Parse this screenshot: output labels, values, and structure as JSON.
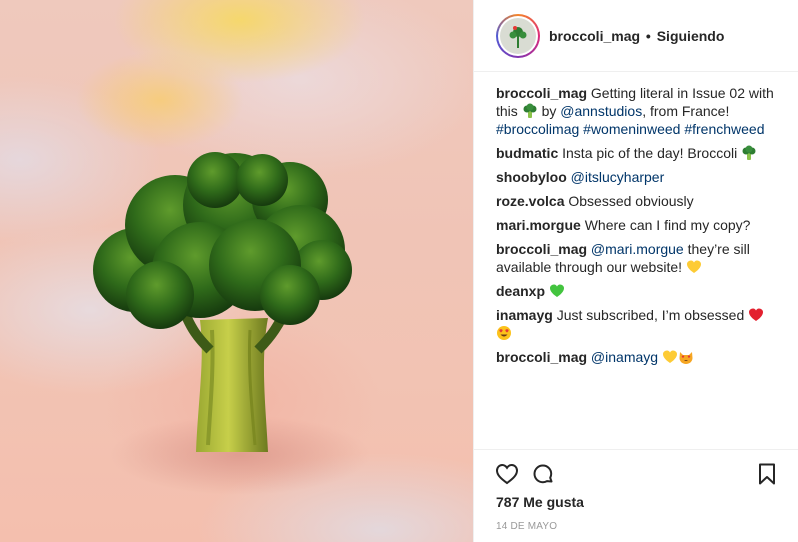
{
  "header": {
    "username": "broccoli_mag",
    "separator": "•",
    "follow_state": "Siguiendo"
  },
  "comments": [
    {
      "user": "broccoli_mag",
      "parts": [
        "Getting literal in Issue 02 with this",
        "by",
        "@annstudios",
        ", from France!",
        "#broccolimag",
        "#womeninweed",
        "#frenchweed"
      ],
      "emoji": [
        "broccoli-emoji"
      ]
    },
    {
      "user": "budmatic",
      "text": "Insta pic of the day! Broccoli",
      "emoji": [
        "broccoli-emoji"
      ]
    },
    {
      "user": "shoobyloo",
      "mention": "@itslucyharper"
    },
    {
      "user": "roze.volca",
      "text": "Obsessed obviously"
    },
    {
      "user": "mari.morgue",
      "text": "Where can I find my copy?"
    },
    {
      "user": "broccoli_mag",
      "mention": "@mari.morgue",
      "text": "they’re sill available through our website!",
      "emoji": [
        "yellow-heart-emoji"
      ]
    },
    {
      "user": "deanxp",
      "emoji": [
        "green-heart-emoji"
      ]
    },
    {
      "user": "inamayg",
      "text": "Just subscribed, I’m obsessed",
      "emoji": [
        "red-heart-emoji",
        "heart-eyes-emoji"
      ]
    },
    {
      "user": "broccoli_mag",
      "mention": "@inamayg",
      "emoji": [
        "yellow-heart-emoji",
        "heart-eyes-cat-emoji"
      ]
    }
  ],
  "footer": {
    "likes": "787 Me gusta",
    "date": "14 DE MAYO"
  },
  "icons": {
    "like": "heart-outline-icon",
    "comment": "comment-bubble-icon",
    "save": "bookmark-icon"
  },
  "colors": {
    "text": "#262626",
    "link": "#003569",
    "muted": "#999999",
    "divider": "#efefef"
  }
}
